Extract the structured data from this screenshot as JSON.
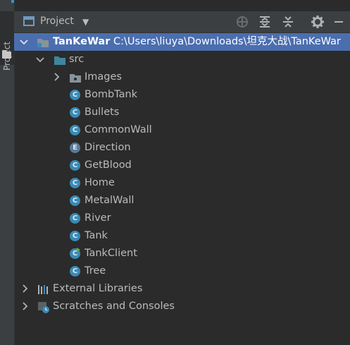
{
  "side_tab": {
    "label": "Project"
  },
  "header": {
    "title": "Project"
  },
  "tree": {
    "root": {
      "name": "TanKeWar",
      "path": "C:\\Users\\liuya\\Downloads\\坦克大战\\TanKeWar"
    },
    "src": {
      "name": "src"
    },
    "images": {
      "name": "Images"
    },
    "classes": [
      {
        "name": "BombTank",
        "kind": "C"
      },
      {
        "name": "Bullets",
        "kind": "C"
      },
      {
        "name": "CommonWall",
        "kind": "C"
      },
      {
        "name": "Direction",
        "kind": "E"
      },
      {
        "name": "GetBlood",
        "kind": "C"
      },
      {
        "name": "Home",
        "kind": "C"
      },
      {
        "name": "MetalWall",
        "kind": "C"
      },
      {
        "name": "River",
        "kind": "C"
      },
      {
        "name": "Tank",
        "kind": "C"
      },
      {
        "name": "TankClient",
        "kind": "C"
      },
      {
        "name": "Tree",
        "kind": "C"
      }
    ],
    "external_libraries": {
      "name": "External Libraries"
    },
    "scratches": {
      "name": "Scratches and Consoles"
    }
  },
  "colors": {
    "selection": "#4b6eaf",
    "background": "#2b2b2b",
    "class_icon": "#3a8ab6",
    "folder": "#3e86a0"
  }
}
